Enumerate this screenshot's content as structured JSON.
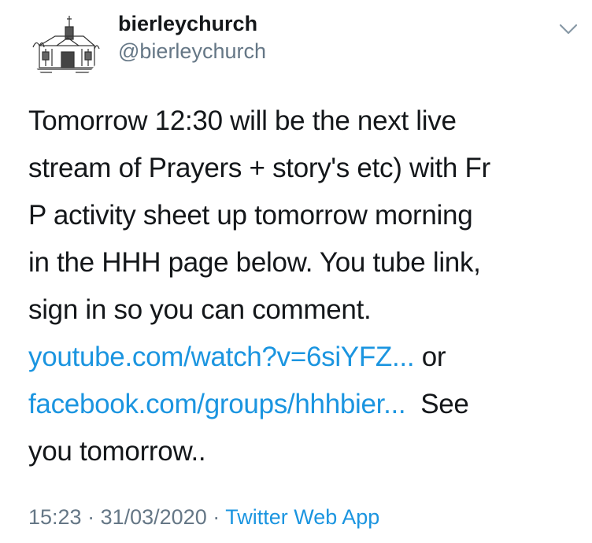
{
  "user": {
    "display_name": "bierleychurch",
    "handle": "@bierleychurch",
    "avatar_icon": "church-building-avatar"
  },
  "tweet": {
    "line1": "Tomorrow 12:30 will be the next live",
    "line2": "stream of Prayers + story's etc) with Fr",
    "line3": "P activity sheet up tomorrow morning",
    "line4": "in the HHH page below. You tube link,",
    "line5": "sign in so you can comment.",
    "link1": "youtube.com/watch?v=6siYFZ...",
    "connector": " or",
    "link2": "facebook.com/groups/hhhbier...",
    "after_link2": "  See",
    "line8": "you tomorrow.."
  },
  "meta": {
    "time": "15:23",
    "separator1": " · ",
    "date": "31/03/2020",
    "separator2": " · ",
    "source": "Twitter Web App"
  },
  "colors": {
    "text": "#14171a",
    "secondary": "#657786",
    "link": "#1b95e0"
  }
}
